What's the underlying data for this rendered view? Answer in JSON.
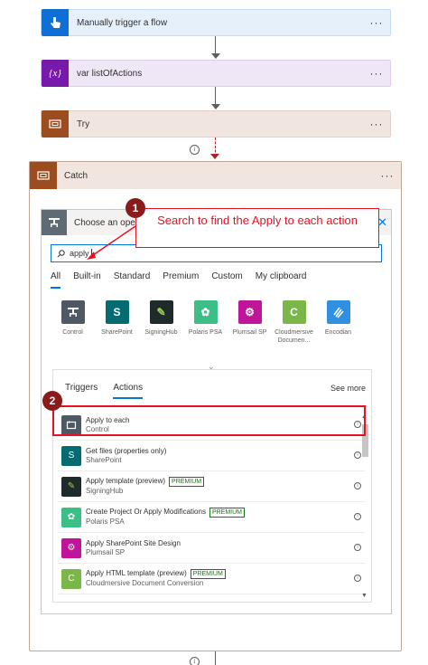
{
  "flow_steps": {
    "trigger": {
      "title": "Manually trigger a flow",
      "more": "···"
    },
    "variable": {
      "title": "var listOfActions",
      "more": "···"
    },
    "try": {
      "title": "Try",
      "more": "···"
    }
  },
  "catch": {
    "title": "Catch",
    "more": "···"
  },
  "picker": {
    "title": "Choose an operation",
    "close": "✕",
    "search_value": "apply",
    "tabs": [
      "All",
      "Built-in",
      "Standard",
      "Premium",
      "Custom",
      "My clipboard"
    ],
    "connectors": [
      {
        "label": "Control",
        "color": "#4f5966"
      },
      {
        "label": "SharePoint",
        "color": "#036c70"
      },
      {
        "label": "SigningHub",
        "color": "#1f2a2b"
      },
      {
        "label": "Polaris PSA",
        "color": "#3bbf86"
      },
      {
        "label": "Plumsail SP",
        "color": "#c0149a"
      },
      {
        "label": "Cloudmersive Documen...",
        "color": "#7ab648"
      },
      {
        "label": "Encodian",
        "color": "#2f8fe0"
      }
    ],
    "lower_tabs": [
      "Triggers",
      "Actions"
    ],
    "see_more": "See more",
    "actions": [
      {
        "name": "Apply to each",
        "sub": "Control",
        "color": "#4f5966",
        "premium": false
      },
      {
        "name": "Get files (properties only)",
        "sub": "SharePoint",
        "color": "#036c70",
        "premium": false
      },
      {
        "name": "Apply template (preview)",
        "sub": "SigningHub",
        "color": "#1f2a2b",
        "premium": true
      },
      {
        "name": "Create Project Or Apply Modifications",
        "sub": "Polaris PSA",
        "color": "#3bbf86",
        "premium": true
      },
      {
        "name": "Apply SharePoint Site Design",
        "sub": "Plumsail SP",
        "color": "#c0149a",
        "premium": false
      },
      {
        "name": "Apply HTML template (preview)",
        "sub": "Cloudmersive Document Conversion",
        "color": "#7ab648",
        "premium": true
      }
    ],
    "premium_label": "PREMIUM"
  },
  "annotations": {
    "callout": "Search to find the Apply to each action",
    "badge1": "1",
    "badge2": "2"
  }
}
